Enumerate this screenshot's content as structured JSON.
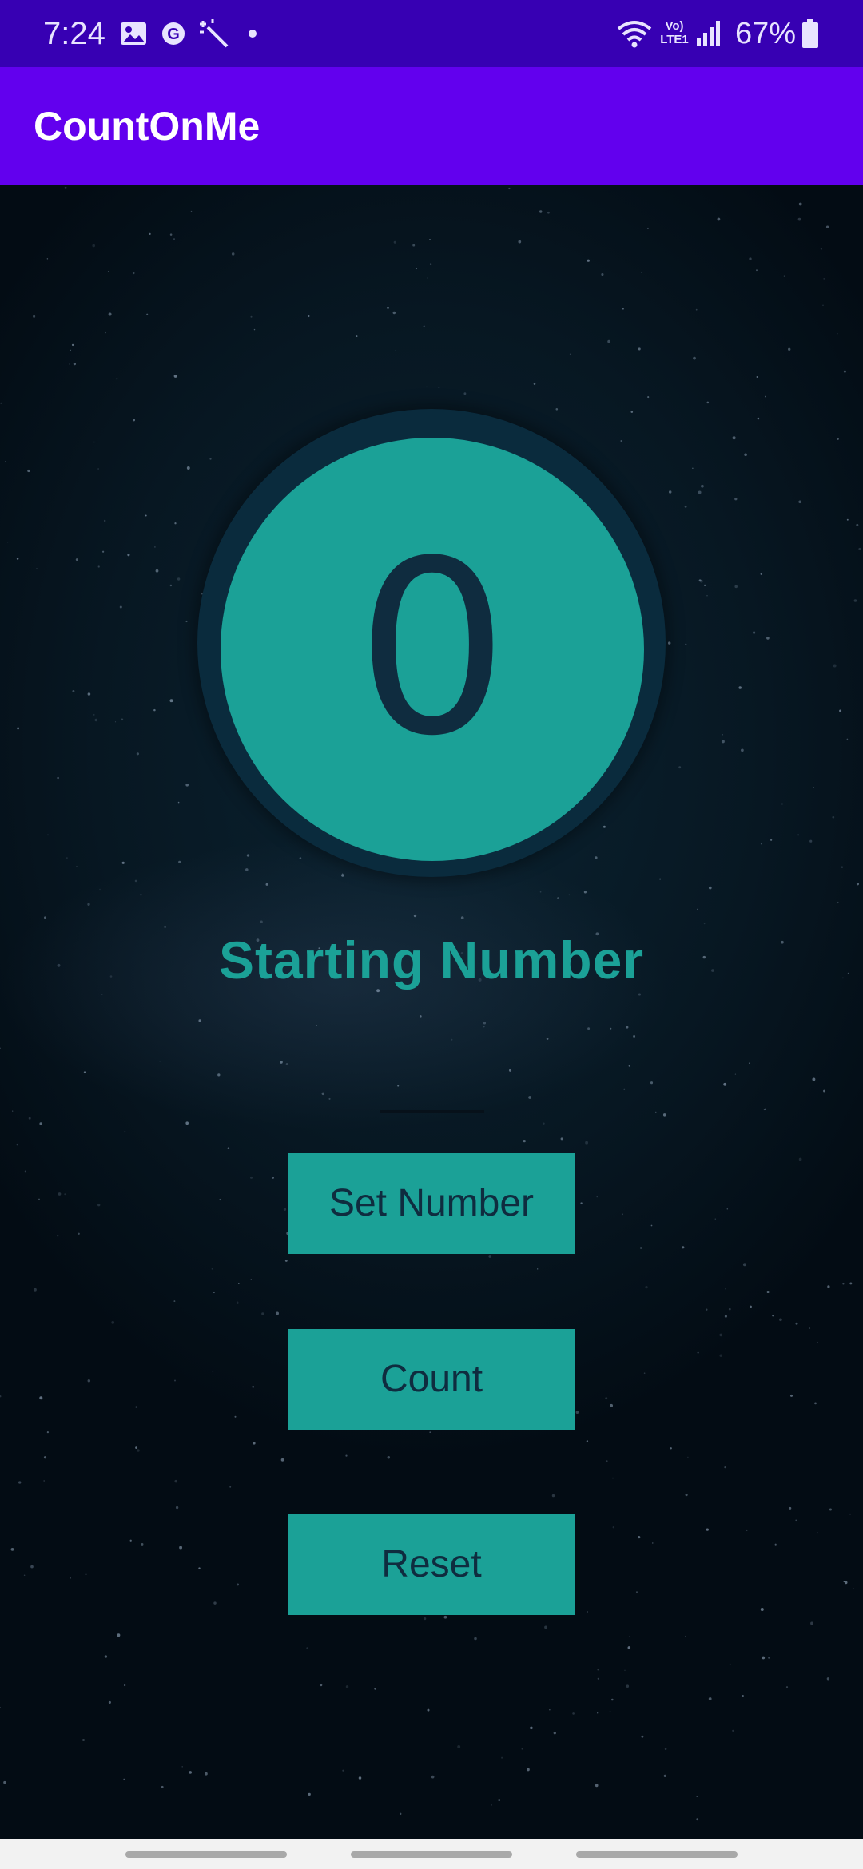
{
  "status_bar": {
    "time": "7:24",
    "battery_percent": "67%",
    "network_label": "Vo) LTE1",
    "icons": [
      "image-icon",
      "g-app-icon",
      "magic-wand-icon",
      "notification-dot-icon",
      "wifi-icon",
      "lte-icon",
      "signal-icon",
      "battery-icon"
    ]
  },
  "app_bar": {
    "title": "CountOnMe"
  },
  "counter": {
    "value": "0",
    "label": "Starting Number"
  },
  "input": {
    "value": ""
  },
  "buttons": {
    "set_number": "Set Number",
    "count": "Count",
    "reset": "Reset"
  },
  "colors": {
    "status_bar": "#3700b3",
    "app_bar": "#6200ee",
    "accent_teal": "#1ba197",
    "dark_text": "#0f2c3f",
    "background": "#04121c"
  }
}
